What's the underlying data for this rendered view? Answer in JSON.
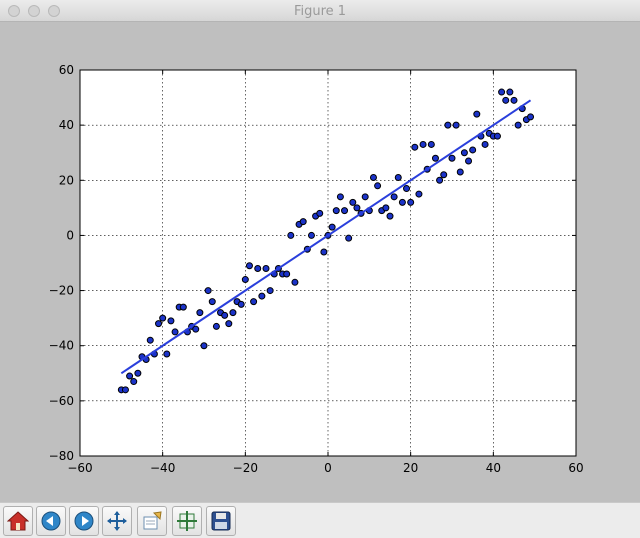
{
  "window": {
    "title": "Figure 1"
  },
  "toolbar": {
    "buttons": [
      {
        "name": "home-icon"
      },
      {
        "name": "back-icon"
      },
      {
        "name": "forward-icon"
      },
      {
        "name": "pan-icon"
      },
      {
        "name": "zoom-icon"
      },
      {
        "name": "subplots-icon"
      },
      {
        "name": "save-icon"
      }
    ]
  },
  "colors": {
    "fit_line": "#2a3fdc",
    "points": "#1b33c9",
    "background": "#bfbfbf"
  },
  "chart_data": {
    "type": "scatter",
    "title": "",
    "xlabel": "",
    "ylabel": "",
    "xlim": [
      -60,
      60
    ],
    "ylim": [
      -80,
      60
    ],
    "xticks": [
      "−60",
      "−40",
      "−20",
      "0",
      "20",
      "40",
      "60"
    ],
    "yticks": [
      "60",
      "40",
      "20",
      "0",
      "−20",
      "−40",
      "−60",
      "−80"
    ],
    "grid": true,
    "series": [
      {
        "kind": "points",
        "x": [
          -50,
          -49,
          -48,
          -47,
          -46,
          -45,
          -44,
          -43,
          -42,
          -41,
          -40,
          -39,
          -38,
          -37,
          -36,
          -35,
          -34,
          -33,
          -32,
          -31,
          -30,
          -29,
          -28,
          -27,
          -26,
          -25,
          -24,
          -23,
          -22,
          -21,
          -20,
          -19,
          -18,
          -17,
          -16,
          -15,
          -14,
          -13,
          -12,
          -11,
          -10,
          -9,
          -8,
          -7,
          -6,
          -5,
          -4,
          -3,
          -2,
          -1,
          0,
          1,
          2,
          3,
          4,
          5,
          6,
          7,
          8,
          9,
          10,
          11,
          12,
          13,
          14,
          15,
          16,
          17,
          18,
          19,
          20,
          21,
          22,
          23,
          24,
          25,
          26,
          27,
          28,
          29,
          30,
          31,
          32,
          33,
          34,
          35,
          36,
          37,
          38,
          39,
          40,
          41,
          42,
          43,
          44,
          45,
          46,
          47,
          48,
          49
        ],
        "y": [
          -56,
          -56,
          -51,
          -53,
          -50,
          -44,
          -45,
          -38,
          -43,
          -32,
          -30,
          -43,
          -31,
          -35,
          -26,
          -26,
          -35,
          -33,
          -34,
          -28,
          -40,
          -20,
          -24,
          -33,
          -28,
          -29,
          -32,
          -28,
          -24,
          -25,
          -16,
          -11,
          -24,
          -12,
          -22,
          -12,
          -20,
          -14,
          -12,
          -14,
          -14,
          0,
          -17,
          4,
          5,
          -5,
          0,
          7,
          8,
          -6,
          0,
          3,
          9,
          14,
          9,
          -1,
          12,
          10,
          8,
          14,
          9,
          21,
          18,
          9,
          10,
          7,
          14,
          21,
          12,
          17,
          12,
          32,
          15,
          33,
          24,
          33,
          28,
          20,
          22,
          40,
          28,
          40,
          23,
          30,
          27,
          31,
          44,
          36,
          33,
          37,
          36,
          36,
          52,
          49,
          52,
          49,
          40,
          46,
          42,
          43
        ]
      },
      {
        "kind": "line",
        "x": [
          -50,
          49
        ],
        "y": [
          -50,
          49
        ]
      }
    ]
  }
}
